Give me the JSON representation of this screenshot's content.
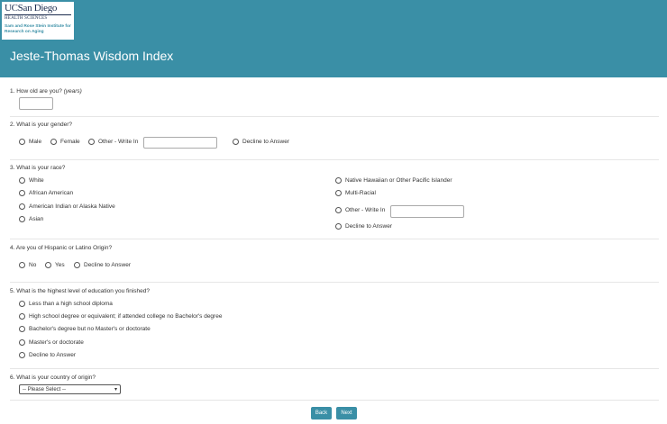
{
  "logo": {
    "uc": "UCSan Diego",
    "health": "HEALTH SCIENCES",
    "institute": "Sam and Rose Stein Institute for Research on Aging"
  },
  "page_title": "Jeste-Thomas Wisdom Index",
  "q1": {
    "label": "1. How old are you?",
    "hint": "(years)",
    "value": ""
  },
  "q2": {
    "label": "2. What is your gender?",
    "options": [
      "Male",
      "Female",
      "Other - Write In",
      "Decline to Answer"
    ],
    "write_in_value": ""
  },
  "q3": {
    "label": "3. What is your race?",
    "options": [
      "White",
      "African American",
      "American Indian or Alaska Native",
      "Asian",
      "Native Hawaiian or Other Pacific Islander",
      "Multi-Racial",
      "Other - Write In",
      "Decline to Answer"
    ],
    "write_in_value": ""
  },
  "q4": {
    "label": "4. Are you of Hispanic or Latino Origin?",
    "options": [
      "No",
      "Yes",
      "Decline to Answer"
    ]
  },
  "q5": {
    "label": "5. What is the highest level of education you finished?",
    "options": [
      "Less than a high school diploma",
      "High school degree or equivalent; if attended college no Bachelor's degree",
      "Bachelor's degree but no Master's or doctorate",
      "Master's or doctorate",
      "Decline to Answer"
    ]
  },
  "q6": {
    "label": "6. What is your country of origin?",
    "selected": "-- Please Select --"
  },
  "buttons": {
    "back": "Back",
    "next": "Next"
  },
  "colors": {
    "header_bg": "#3a8fa6",
    "button_bg": "#3a8fa6"
  }
}
